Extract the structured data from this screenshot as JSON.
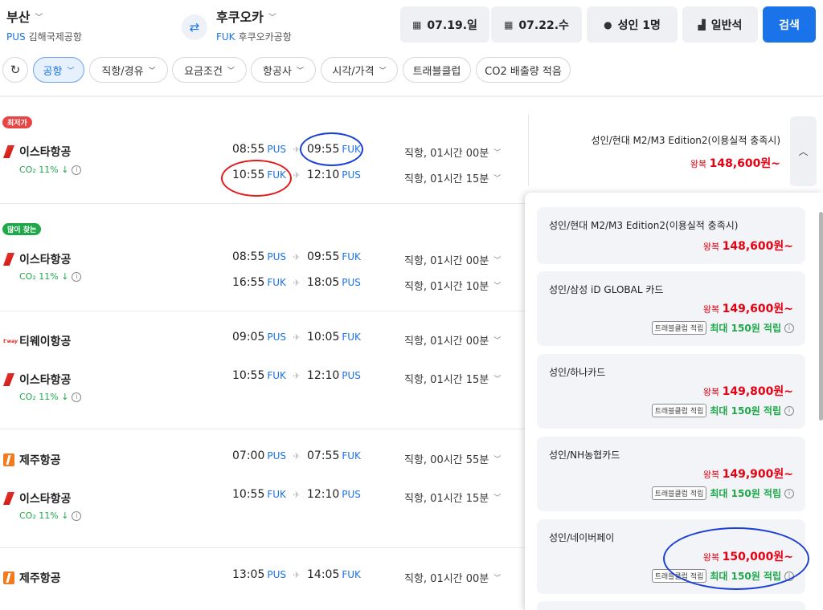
{
  "header": {
    "from": {
      "city": "부산",
      "code": "PUS",
      "airport": "김해국제공항"
    },
    "to": {
      "city": "후쿠오카",
      "code": "FUK",
      "airport": "후쿠오카공항"
    },
    "swap_icon": "⇄",
    "depart_date": "07.19.일",
    "return_date": "07.22.수",
    "passengers": "성인 1명",
    "seat_class": "일반석",
    "search_label": "검색"
  },
  "filters": [
    "공항",
    "직항/경유",
    "요금조건",
    "항공사",
    "시각/가격",
    "트래블클럽",
    "CO2 배출량 적음"
  ],
  "flights": [
    {
      "tag": "최저가",
      "airline1": "이스타항공",
      "co2": "CO₂ 11% ↓",
      "out": {
        "dep": "08:55",
        "dep_ap": "PUS",
        "arr": "09:55",
        "arr_ap": "FUK",
        "dur": "직항, 01시간 00분"
      },
      "ret": {
        "dep": "10:55",
        "dep_ap": "FUK",
        "arr": "12:10",
        "arr_ap": "PUS",
        "dur": "직항, 01시간 15분"
      }
    },
    {
      "tag": "많이 찾는",
      "airline1": "이스타항공",
      "co2": "CO₂ 11% ↓",
      "out": {
        "dep": "08:55",
        "dep_ap": "PUS",
        "arr": "09:55",
        "arr_ap": "FUK",
        "dur": "직항, 01시간 00분"
      },
      "ret": {
        "dep": "16:55",
        "dep_ap": "FUK",
        "arr": "18:05",
        "arr_ap": "PUS",
        "dur": "직항, 01시간 10분"
      }
    },
    {
      "airline1": "티웨이항공",
      "airline2": "이스타항공",
      "co2": "CO₂ 11% ↓",
      "out": {
        "dep": "09:05",
        "dep_ap": "PUS",
        "arr": "10:05",
        "arr_ap": "FUK",
        "dur": "직항, 01시간 00분"
      },
      "ret": {
        "dep": "10:55",
        "dep_ap": "FUK",
        "arr": "12:10",
        "arr_ap": "PUS",
        "dur": "직항, 01시간 15분"
      }
    },
    {
      "airline1": "제주항공",
      "airline2": "이스타항공",
      "co2": "CO₂ 11% ↓",
      "out": {
        "dep": "07:00",
        "dep_ap": "PUS",
        "arr": "07:55",
        "arr_ap": "FUK",
        "dur": "직항, 00시간 55분"
      },
      "ret": {
        "dep": "10:55",
        "dep_ap": "FUK",
        "arr": "12:10",
        "arr_ap": "PUS",
        "dur": "직항, 01시간 15분"
      }
    },
    {
      "airline1": "제주항공",
      "out": {
        "dep": "13:05",
        "dep_ap": "PUS",
        "arr": "14:05",
        "arr_ap": "FUK",
        "dur": "직항, 01시간 00분"
      }
    }
  ],
  "first_price": {
    "name": "성인/현대 M2/M3 Edition2(이용실적 충족시)",
    "prefix": "왕복",
    "amount": "148,600",
    "suffix": "원~"
  },
  "dropdown": [
    {
      "name": "성인/현대 M2/M3 Edition2(이용실적 충족시)",
      "prefix": "왕복",
      "amount": "148,600",
      "suffix": "원~"
    },
    {
      "name": "성인/삼성 iD GLOBAL 카드",
      "prefix": "왕복",
      "amount": "149,600",
      "suffix": "원~",
      "chip": "트래블클럽 적립",
      "points": "최대 150원 적립"
    },
    {
      "name": "성인/하나카드",
      "prefix": "왕복",
      "amount": "149,800",
      "suffix": "원~",
      "chip": "트래블클럽 적립",
      "points": "최대 150원 적립"
    },
    {
      "name": "성인/NH농협카드",
      "prefix": "왕복",
      "amount": "149,900",
      "suffix": "원~",
      "chip": "트래블클럽 적립",
      "points": "최대 150원 적립"
    },
    {
      "name": "성인/네이버페이",
      "prefix": "왕복",
      "amount": "150,000",
      "suffix": "원~",
      "chip": "트래블클럽 적립",
      "points": "최대 150원 적립"
    }
  ],
  "info_icon": "i",
  "chev_down": "﹀",
  "chev_up": "︿",
  "plane_icon": "✈",
  "colors": {
    "accent": "#1a73e8",
    "price": "#e60012",
    "eco": "#1fa84a",
    "annotation_blue": "#1a3fd6",
    "annotation_red": "#e21a1a"
  }
}
